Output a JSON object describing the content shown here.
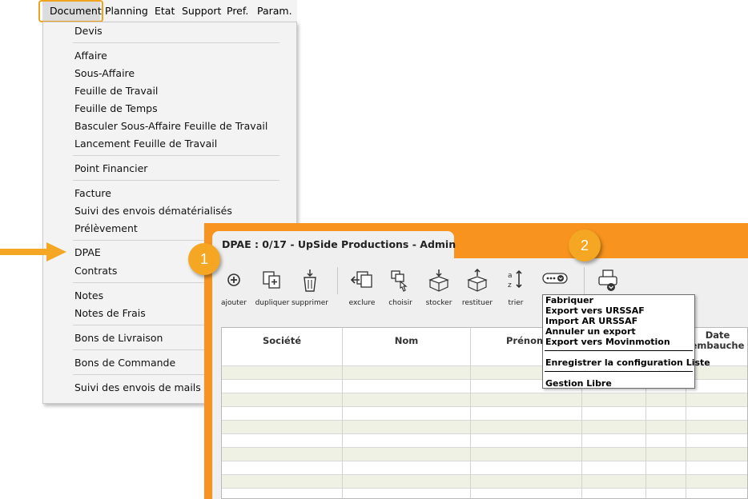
{
  "menubar": {
    "items": [
      "Document",
      "Planning",
      "Etat",
      "Support",
      "Pref.",
      "Param."
    ]
  },
  "document_menu": {
    "groups": [
      [
        "Devis"
      ],
      [
        "Affaire",
        "Sous-Affaire",
        "Feuille de Travail",
        "Feuille de Temps",
        "Basculer Sous-Affaire  Feuille de Travail",
        "Lancement Feuille de Travail"
      ],
      [
        "Point Financier"
      ],
      [
        "Facture",
        "Suivi des envois dématérialisés",
        "Prélèvement"
      ],
      [
        "DPAE",
        "Contrats"
      ],
      [
        "Notes",
        "Notes de Frais"
      ],
      [
        "Bons de Livraison"
      ],
      [
        "Bons de Commande"
      ],
      [
        "Suivi des envois de mails"
      ]
    ]
  },
  "window": {
    "tab_title": "DPAE : 0/17 - UpSide Productions - Admin",
    "toolbar": [
      {
        "label": "ajouter",
        "icon": "add-icon"
      },
      {
        "label": "dupliquer",
        "icon": "duplicate-icon"
      },
      {
        "label": "supprimer",
        "icon": "trash-icon"
      },
      {
        "label": "exclure",
        "icon": "exclude-icon"
      },
      {
        "label": "choisir",
        "icon": "choose-icon"
      },
      {
        "label": "stocker",
        "icon": "store-box-icon"
      },
      {
        "label": "restituer",
        "icon": "restore-box-icon"
      },
      {
        "label": "trier",
        "icon": "sort-az-icon"
      }
    ],
    "more_icon": "more-options-icon",
    "print_icon": "print-icon",
    "grid": {
      "headers": [
        "Société",
        "Nom",
        "Prénom",
        "",
        "",
        "Date\nembauche"
      ]
    },
    "popup_menu": {
      "items_a": [
        "Fabriquer",
        "Export vers URSSAF",
        "Import AR URSSAF",
        "Annuler un export",
        "Export vers Movinmotion"
      ],
      "items_b": [
        "Enregistrer la configuration Liste"
      ],
      "items_c": [
        "Gestion Libre"
      ]
    }
  },
  "annotations": {
    "badge_1": "1",
    "badge_2": "2"
  },
  "colors": {
    "accent_orange": "#f7931e",
    "badge_orange": "#f5a623",
    "highlight_orange": "#f0a41e",
    "row_alt": "#eef1e4"
  }
}
